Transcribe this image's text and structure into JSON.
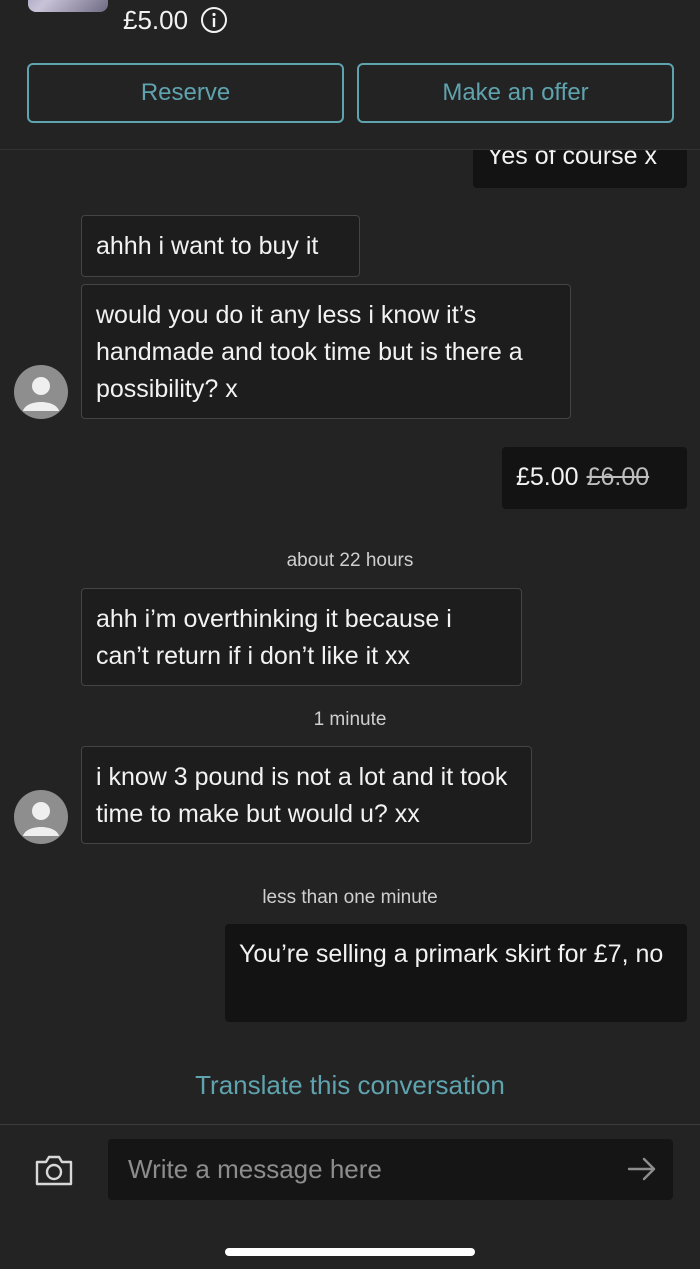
{
  "listing": {
    "price": "£5.00",
    "info_icon": "info-icon"
  },
  "actions": {
    "reserve_label": "Reserve",
    "offer_label": "Make an offer"
  },
  "messages": {
    "m0": "Yes of course x",
    "m1": "ahhh i want to buy it",
    "m2": "would you do it any less i know it’s handmade and took time but is there a possibility? x",
    "offer_new_price": "£5.00",
    "offer_old_price": "£6.00",
    "ts1": "about 22 hours",
    "m3": "ahh i’m overthinking it because i can’t return if i don’t like it xx",
    "ts2": "1 minute",
    "m4": "i know 3 pound is not a lot  and it took time to make but would u? xx",
    "ts3": "less than one minute",
    "m5": "You’re selling a primark skirt for £7, no"
  },
  "translate_label": "Translate this conversation",
  "composer": {
    "placeholder": "Write a message here",
    "camera_icon": "camera-icon",
    "send_icon": "send-arrow-icon"
  },
  "colors": {
    "accent": "#5fa3ae",
    "background": "#232323",
    "bubble": "#151515"
  }
}
